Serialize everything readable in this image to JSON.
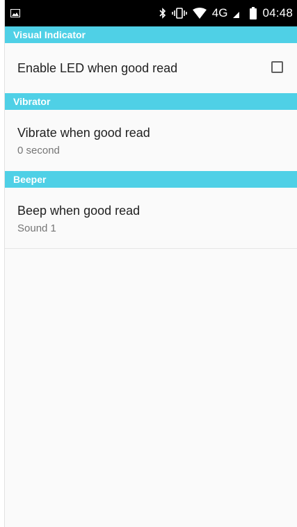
{
  "status_bar": {
    "icons": [
      "picture-icon",
      "bluetooth-icon",
      "vibrate-icon",
      "wifi-icon",
      "signal-icon",
      "battery-icon"
    ],
    "network_label": "4G",
    "time": "04:48"
  },
  "sections": {
    "visual_indicator": {
      "header": "Visual Indicator",
      "item_title": "Enable LED when good read",
      "checked": false
    },
    "vibrator": {
      "header": "Vibrator",
      "item_title": "Vibrate when good read",
      "item_summary": "0 second"
    },
    "beeper": {
      "header": "Beeper",
      "item_title": "Beep when good read",
      "item_summary": "Sound 1"
    }
  },
  "colors": {
    "header_bg": "#4fd0e6",
    "status_bar_bg": "#000000",
    "background": "#fafafa"
  }
}
